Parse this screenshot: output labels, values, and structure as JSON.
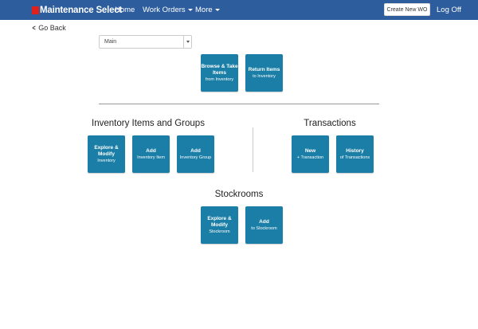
{
  "navbar": {
    "brand_mark": "R",
    "brand_text": "Maintenance Select",
    "home": "Home",
    "work_orders": "Work Orders",
    "more": "More",
    "create_wo": "Create New WO",
    "log_off": "Log Off"
  },
  "go_back": "Go Back",
  "stockroom_select": {
    "value": "Main"
  },
  "top_tiles": [
    {
      "main": "Browse & Take Items",
      "sub": "from Inventory"
    },
    {
      "main": "Return Items",
      "sub": "to Inventory"
    }
  ],
  "inventory_section": {
    "title": "Inventory Items and Groups",
    "tiles": [
      {
        "main": "Explore & Modify",
        "sub": "Inventory"
      },
      {
        "main": "Add",
        "sub": "Inventory Item"
      },
      {
        "main": "Add",
        "sub": "Inventory Group"
      }
    ]
  },
  "transactions_section": {
    "title": "Transactions",
    "tiles": [
      {
        "main": "New",
        "sub": "+ Transaction"
      },
      {
        "main": "History",
        "sub": "of Transactions"
      }
    ]
  },
  "stockrooms_section": {
    "title": "Stockrooms",
    "tiles": [
      {
        "main": "Explore & Modify",
        "sub": "Stockroom"
      },
      {
        "main": "Add",
        "sub": "to Stockroom"
      }
    ]
  },
  "colors": {
    "navbar": "#2d5d9c",
    "tile": "#1a7ea6",
    "brand_mark": "#e0201b"
  }
}
